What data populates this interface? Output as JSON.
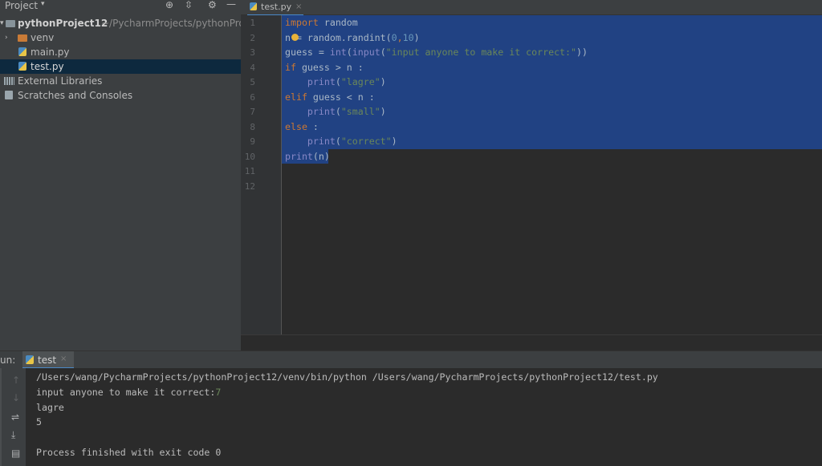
{
  "project_panel": {
    "header_label": "Project",
    "tree": [
      {
        "label": "pythonProject12",
        "path": "~/PycharmProjects/pythonProje",
        "type": "project"
      },
      {
        "label": "venv",
        "type": "folder"
      },
      {
        "label": "main.py",
        "type": "python-file"
      },
      {
        "label": "test.py",
        "type": "python-file",
        "selected": true
      },
      {
        "label": "External Libraries",
        "type": "libraries"
      },
      {
        "label": "Scratches and Consoles",
        "type": "scratches"
      }
    ]
  },
  "editor": {
    "tab_label": "test.py",
    "line_numbers": [
      "1",
      "2",
      "3",
      "4",
      "5",
      "6",
      "7",
      "8",
      "9",
      "10",
      "11",
      "12"
    ],
    "lines": [
      [
        {
          "t": "import",
          "c": "kw"
        },
        {
          "t": " random",
          "c": ""
        }
      ],
      [
        {
          "t": "n = random.randint(",
          "c": ""
        },
        {
          "t": "0",
          "c": "num"
        },
        {
          "t": ",",
          "c": "kw"
        },
        {
          "t": "10",
          "c": "num"
        },
        {
          "t": ")",
          "c": ""
        }
      ],
      [
        {
          "t": "guess = ",
          "c": ""
        },
        {
          "t": "int",
          "c": "bi"
        },
        {
          "t": "(",
          "c": ""
        },
        {
          "t": "input",
          "c": "bi"
        },
        {
          "t": "(",
          "c": ""
        },
        {
          "t": "\"input anyone to make it correct:\"",
          "c": "str"
        },
        {
          "t": "))",
          "c": ""
        }
      ],
      [
        {
          "t": "if",
          "c": "kw"
        },
        {
          "t": " guess > n :",
          "c": ""
        }
      ],
      [
        {
          "t": "    ",
          "c": ""
        },
        {
          "t": "print",
          "c": "bi"
        },
        {
          "t": "(",
          "c": ""
        },
        {
          "t": "\"lagre\"",
          "c": "str"
        },
        {
          "t": ")",
          "c": ""
        }
      ],
      [
        {
          "t": "elif",
          "c": "kw"
        },
        {
          "t": " guess < n :",
          "c": ""
        }
      ],
      [
        {
          "t": "    ",
          "c": ""
        },
        {
          "t": "print",
          "c": "bi"
        },
        {
          "t": "(",
          "c": ""
        },
        {
          "t": "\"small\"",
          "c": "str"
        },
        {
          "t": ")",
          "c": ""
        }
      ],
      [
        {
          "t": "else",
          "c": "kw"
        },
        {
          "t": " :",
          "c": ""
        }
      ],
      [
        {
          "t": "    ",
          "c": ""
        },
        {
          "t": "print",
          "c": "bi"
        },
        {
          "t": "(",
          "c": ""
        },
        {
          "t": "\"correct\"",
          "c": "str"
        },
        {
          "t": ")",
          "c": ""
        }
      ],
      [
        {
          "t": "print",
          "c": "bi"
        },
        {
          "t": "(n)",
          "c": ""
        }
      ],
      [],
      []
    ]
  },
  "run_panel": {
    "header_label": "un:",
    "tab_label": "test",
    "console_lines": [
      "/Users/wang/PycharmProjects/pythonProject12/venv/bin/python /Users/wang/PycharmProjects/pythonProject12/test.py",
      "input anyone to make it correct:",
      "lagre",
      "5",
      "",
      "Process finished with exit code 0"
    ],
    "user_input": "7"
  },
  "colors": {
    "selection": "#214283",
    "keyword": "#cc7832",
    "string": "#6a8759",
    "number": "#6897bb",
    "user_input": "#6a8759"
  }
}
